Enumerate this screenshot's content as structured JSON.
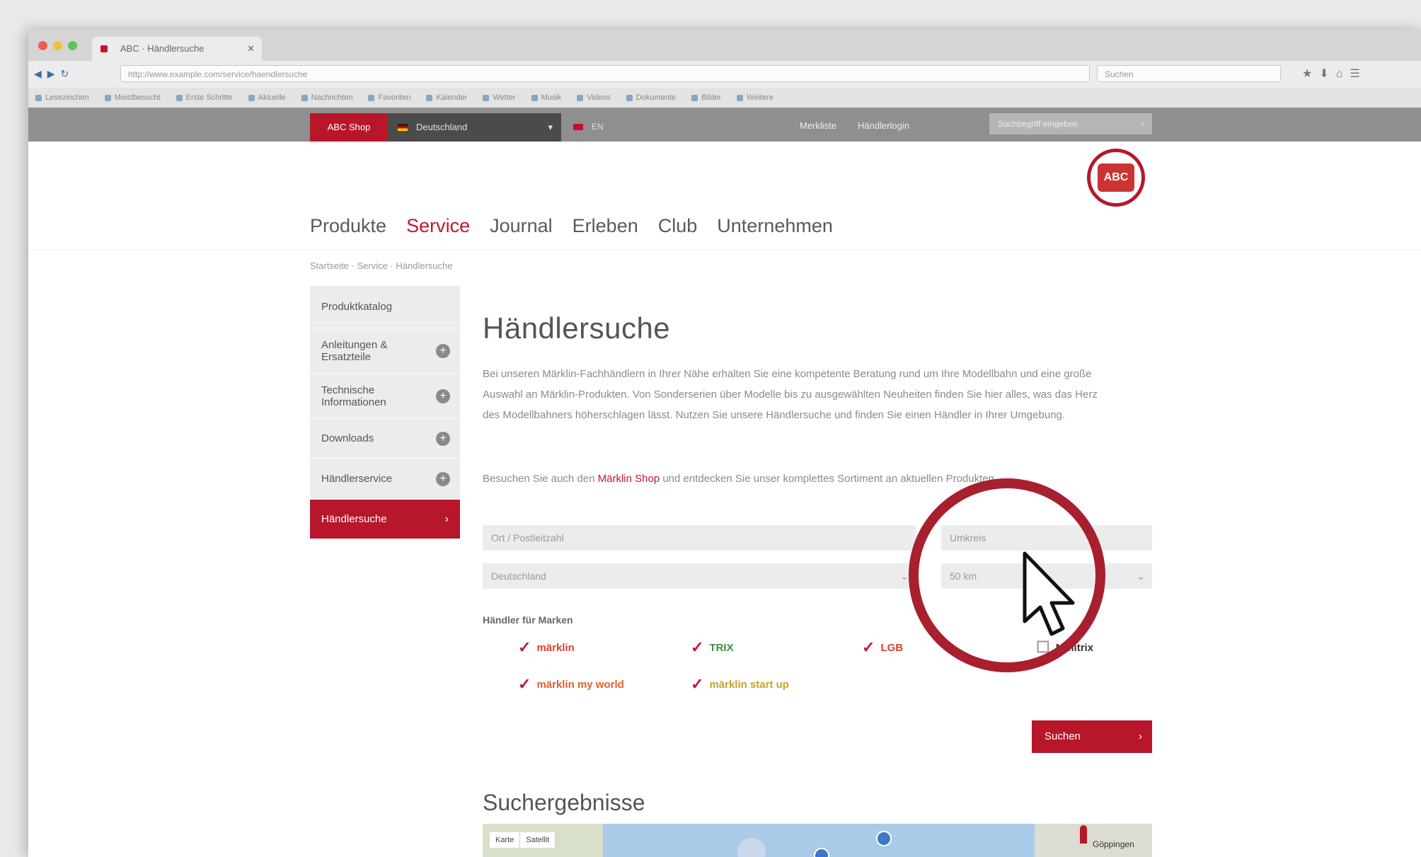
{
  "browser": {
    "tab_title": "ABC · Händlersuche",
    "url": "http://www.example.com/service/haendlersuche",
    "search_placeholder": "Suchen",
    "bookmarks": [
      "Lesezeichen",
      "Meistbesucht",
      "Erste Schritte",
      "Aktuelle",
      "Nachrichten",
      "Favoriten",
      "Kalender",
      "Wetter",
      "Musik",
      "Videos",
      "Dokumente",
      "Bilder",
      "Weitere"
    ]
  },
  "site_topbar": {
    "red_button": "ABC Shop",
    "country": "Deutschland",
    "language": "EN",
    "links": [
      "Merkliste",
      "Händlerlogin"
    ],
    "search_placeholder": "Suchbegriff eingeben"
  },
  "logo_text": "ABC",
  "nav": {
    "items": [
      "Produkte",
      "Service",
      "Journal",
      "Erleben",
      "Club",
      "Unternehmen"
    ],
    "active_index": 1
  },
  "breadcrumb": "Startseite · Service · Händlersuche",
  "sidebar": {
    "items": [
      {
        "label": "Produktkatalog",
        "has_plus": false,
        "active": false
      },
      {
        "label": "Anleitungen & Ersatzteile",
        "has_plus": true,
        "active": false
      },
      {
        "label": "Technische Informationen",
        "has_plus": true,
        "active": false
      },
      {
        "label": "Downloads",
        "has_plus": true,
        "active": false
      },
      {
        "label": "Händlerservice",
        "has_plus": true,
        "active": false
      },
      {
        "label": "Händlersuche",
        "has_plus": false,
        "active": true
      }
    ]
  },
  "page": {
    "title": "Händlersuche",
    "intro": "Bei unseren Märklin-Fachhändlern in Ihrer Nähe erhalten Sie eine kompetente Beratung rund um Ihre Modellbahn und eine große Auswahl an Märklin-Produkten. Von Sonderserien über Modelle bis zu ausgewählten Neuheiten finden Sie hier alles, was das Herz des Modellbahners höherschlagen lässt. Nutzen Sie unsere Händlersuche und finden Sie einen Händler in Ihrer Umgebung.",
    "hint_prefix": "Besuchen Sie auch den ",
    "hint_link": "Märklin Shop",
    "hint_suffix": " und entdecken Sie unser komplettes Sortiment an aktuellen Produkten.",
    "search_field_placeholder": "Ort / Postleitzahl",
    "radius_placeholder": "Umkreis",
    "country_select": "Deutschland",
    "distance_select": "50 km",
    "brands_label": "Händler für Marken",
    "brands": [
      {
        "name": "märklin",
        "checked": true,
        "color": "#d9422e"
      },
      {
        "name": "TRIX",
        "checked": true,
        "color": "#3f8f45"
      },
      {
        "name": "LGB",
        "checked": true,
        "color": "#d9422e"
      },
      {
        "name": "Minitrix",
        "checked": false,
        "color": "#333333"
      },
      {
        "name": "märklin my world",
        "checked": true,
        "color": "#e0602a"
      },
      {
        "name": "märklin start up",
        "checked": true,
        "color": "#c9a22a"
      }
    ],
    "search_button": "Suchen",
    "results_title": "Suchergebnisse",
    "map_controls": [
      "Karte",
      "Satellit"
    ],
    "map_place": "Göppingen"
  },
  "colors": {
    "brand_red": "#b8172b",
    "ring_red": "#a81f2e"
  }
}
